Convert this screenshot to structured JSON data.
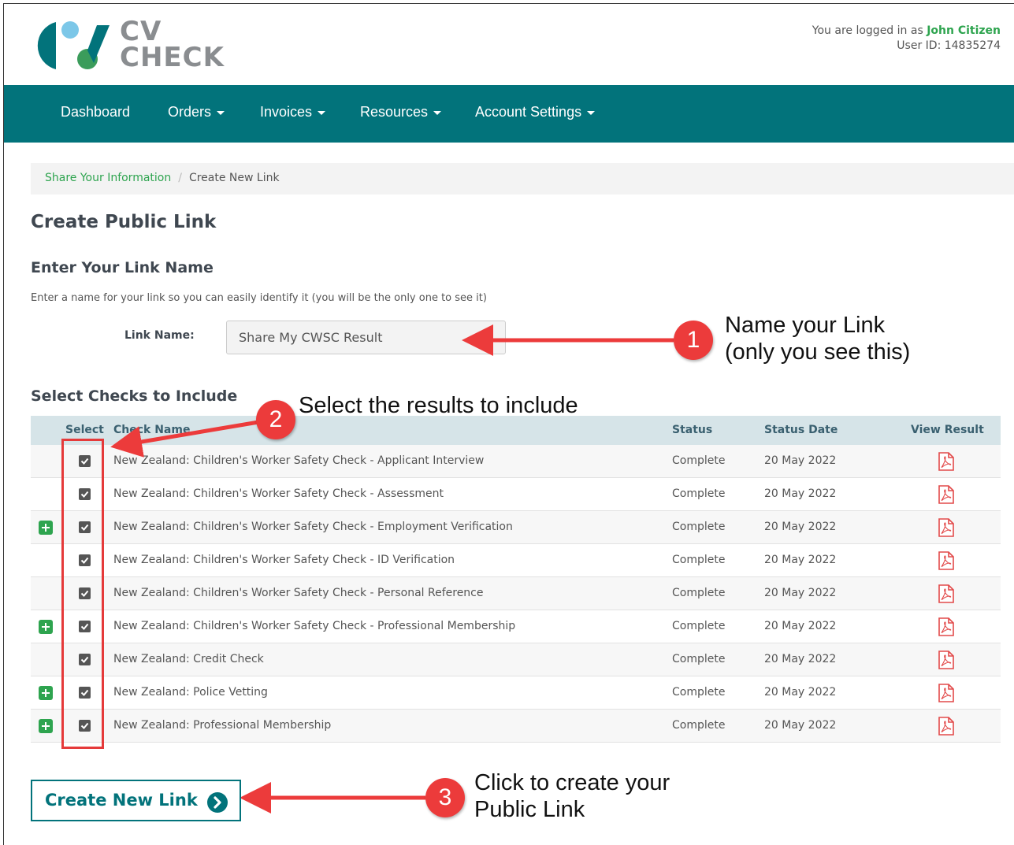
{
  "brand": {
    "logo_line1": "CV",
    "logo_line2": "CHECK",
    "teal": "#02737b",
    "green": "#2ea44f"
  },
  "user": {
    "prefix": "You are logged in as",
    "name": "John Citizen",
    "id_line": "User ID: 14835274"
  },
  "nav": {
    "dashboard": "Dashboard",
    "orders": "Orders",
    "invoices": "Invoices",
    "resources": "Resources",
    "account_settings": "Account Settings"
  },
  "breadcrumb": {
    "parent": "Share Your Information",
    "separator": "/",
    "current": "Create New Link"
  },
  "page": {
    "title": "Create Public Link",
    "link_section_title": "Enter Your Link Name",
    "link_hint": "Enter a name for your link so you can easily identify it (you will be the only one to see it)",
    "link_label": "Link Name:",
    "link_value": "Share My CWSC Result",
    "checks_title": "Select Checks to Include"
  },
  "table": {
    "headers": {
      "select": "Select",
      "check_name": "Check Name",
      "status": "Status",
      "status_date": "Status Date",
      "view_result": "View Result"
    },
    "rows": [
      {
        "name": "New Zealand: Children's Worker Safety Check - Applicant Interview",
        "status": "Complete",
        "date": "20 May 2022",
        "expandable": false,
        "checked": true
      },
      {
        "name": "New Zealand: Children's Worker Safety Check - Assessment",
        "status": "Complete",
        "date": "20 May 2022",
        "expandable": false,
        "checked": true
      },
      {
        "name": "New Zealand: Children's Worker Safety Check - Employment Verification",
        "status": "Complete",
        "date": "20 May 2022",
        "expandable": true,
        "checked": true
      },
      {
        "name": "New Zealand: Children's Worker Safety Check - ID Verification",
        "status": "Complete",
        "date": "20 May 2022",
        "expandable": false,
        "checked": true
      },
      {
        "name": "New Zealand: Children's Worker Safety Check - Personal Reference",
        "status": "Complete",
        "date": "20 May 2022",
        "expandable": false,
        "checked": true
      },
      {
        "name": "New Zealand: Children's Worker Safety Check - Professional Membership",
        "status": "Complete",
        "date": "20 May 2022",
        "expandable": true,
        "checked": true
      },
      {
        "name": "New Zealand: Credit Check",
        "status": "Complete",
        "date": "20 May 2022",
        "expandable": false,
        "checked": true
      },
      {
        "name": "New Zealand: Police Vetting",
        "status": "Complete",
        "date": "20 May 2022",
        "expandable": true,
        "checked": true
      },
      {
        "name": "New Zealand: Professional Membership",
        "status": "Complete",
        "date": "20 May 2022",
        "expandable": true,
        "checked": true
      }
    ]
  },
  "button": {
    "label": "Create New Link"
  },
  "annotations": {
    "one": {
      "number": "1",
      "line1": "Name your Link",
      "line2": "(only you see this)"
    },
    "two": {
      "number": "2",
      "text": "Select the results to include"
    },
    "three": {
      "number": "3",
      "line1": "Click to create your",
      "line2": "Public Link"
    },
    "color": "#ec3b3b"
  }
}
